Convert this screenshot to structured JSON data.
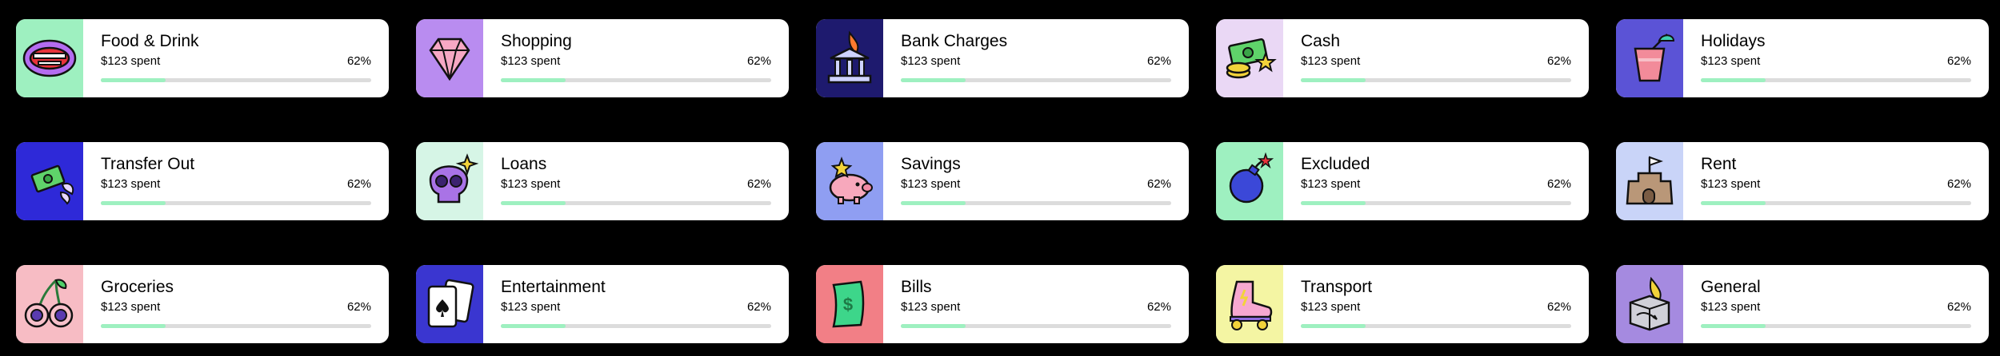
{
  "accent_color": "#9ef0c0",
  "track_color": "#dcdcdc",
  "categories": [
    {
      "name": "Food & Drink",
      "spent": "$123 spent",
      "percent": "62%",
      "progress": 0.24,
      "tile_color": "#9ef0c0",
      "icon": "lips-icon"
    },
    {
      "name": "Shopping",
      "spent": "$123 spent",
      "percent": "62%",
      "progress": 0.24,
      "tile_color": "#b98cf0",
      "icon": "gem-icon"
    },
    {
      "name": "Bank Charges",
      "spent": "$123 spent",
      "percent": "62%",
      "progress": 0.24,
      "tile_color": "#1e1a6e",
      "icon": "bank-fire-icon"
    },
    {
      "name": "Cash",
      "spent": "$123 spent",
      "percent": "62%",
      "progress": 0.24,
      "tile_color": "#ead8f5",
      "icon": "cash-icon"
    },
    {
      "name": "Holidays",
      "spent": "$123 spent",
      "percent": "62%",
      "progress": 0.24,
      "tile_color": "#5b53d6",
      "icon": "cocktail-icon"
    },
    {
      "name": "Transfer Out",
      "spent": "$123 spent",
      "percent": "62%",
      "progress": 0.24,
      "tile_color": "#2e29d8",
      "icon": "flying-money-icon"
    },
    {
      "name": "Loans",
      "spent": "$123 spent",
      "percent": "62%",
      "progress": 0.24,
      "tile_color": "#d6f5e6",
      "icon": "skull-icon"
    },
    {
      "name": "Savings",
      "spent": "$123 spent",
      "percent": "62%",
      "progress": 0.24,
      "tile_color": "#8f9ef2",
      "icon": "piggy-bank-icon"
    },
    {
      "name": "Excluded",
      "spent": "$123 spent",
      "percent": "62%",
      "progress": 0.24,
      "tile_color": "#9ef0c0",
      "icon": "bomb-icon"
    },
    {
      "name": "Rent",
      "spent": "$123 spent",
      "percent": "62%",
      "progress": 0.24,
      "tile_color": "#c9d4f8",
      "icon": "sandcastle-icon"
    },
    {
      "name": "Groceries",
      "spent": "$123 spent",
      "percent": "62%",
      "progress": 0.24,
      "tile_color": "#f7bcc4",
      "icon": "cherries-icon"
    },
    {
      "name": "Entertainment",
      "spent": "$123 spent",
      "percent": "62%",
      "progress": 0.24,
      "tile_color": "#3a36d0",
      "icon": "playing-cards-icon"
    },
    {
      "name": "Bills",
      "spent": "$123 spent",
      "percent": "62%",
      "progress": 0.24,
      "tile_color": "#f27f86",
      "icon": "dollar-bill-icon"
    },
    {
      "name": "Transport",
      "spent": "$123 spent",
      "percent": "62%",
      "progress": 0.24,
      "tile_color": "#f4f5a3",
      "icon": "roller-skate-icon"
    },
    {
      "name": "General",
      "spent": "$123 spent",
      "percent": "62%",
      "progress": 0.24,
      "tile_color": "#a58ae0",
      "icon": "box-fire-icon"
    }
  ]
}
